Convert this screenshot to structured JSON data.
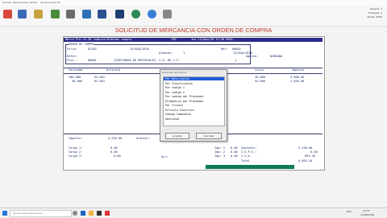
{
  "menu": [
    "Archivo",
    "Operaciones",
    "Ventas",
    "Ayuda Acerca de"
  ],
  "top_right": {
    "line1": "Usuario: 1",
    "line2": "Empresa: 1",
    "line3": "Fecha: 2020"
  },
  "app_title": "SOLICITUD DE MERCANCIA CON ORDEN DE COMPRA",
  "header": {
    "program": "Macro Pro v3.30 compras/Ordenes compra",
    "code": "750",
    "date_line": "Jue 13/Ago/20 13:36 0001.",
    "section": "ORDEN DE COMPRA",
    "folio_label": "Folio:",
    "folio_value": "OCO02",
    "date1": "13/AGO/2020",
    "ref_label": "Ref:",
    "ref_value": "00002",
    "date2": "13/AGO/2020",
    "almacen_label": "Almacen:",
    "almacen_value": "1",
    "refer_label": "Refer:",
    "agente_label": "Agente:",
    "agente_value": "NINGUNO",
    "prov_label": "Prov :",
    "prov_code": "00001",
    "prov_name": "[SURTIDORA DE MATERIALES, S.A. DE C.V.",
    "prov_end": "]"
  },
  "table": {
    "headers": [
      "Cantidad",
      "Articulo",
      "Costo",
      "Importe"
    ],
    "rows": [
      {
        "qty": "100.000",
        "art": "63-002",
        "cost": "36.000",
        "imp": "3,600.00"
      },
      {
        "qty": "50.000",
        "art": "63-001",
        "cost": "54.000",
        "imp": "1,620.00"
      }
    ]
  },
  "totals": {
    "importe_label": "Importe:",
    "importe_value": "5,220.00",
    "arancel_label": "Arancel:",
    "cargo1_label": "Cargo 1:",
    "cargo1_value": "0.00",
    "cargo2_label": "Cargo 2:",
    "cargo2_value": "0.00",
    "cargo3_label": "Cargo 3:",
    "cargo3_value": "0.00",
    "acr_label": "Acr:",
    "imp1_label": "Imp: 1",
    "imp1_value": "0.00",
    "imp2_label": "Imp: 2",
    "imp2_value": "0.00",
    "imp3_label": "Imp: 3",
    "imp3_value": "0.00",
    "subtotal_label": "Subtotal:",
    "subtotal_value": "5,220.00",
    "ieps_label": "I.E.P.S.:",
    "ieps_value": "0.00",
    "iva_label": "I.V.A.",
    "iva_value": "835.20",
    "total_label": "Total",
    "total_value": "6,055.20"
  },
  "dialog": {
    "title": "Busqueda del articulo",
    "items": [
      "Por Descripcion",
      "Por Clasificacion",
      "Por codigo 1",
      "Por codigo 2",
      "Por codigo del Proveedor",
      "Alfabetico por Proveedor",
      "Por Cliente",
      "Articulo Sustituto",
      "Codigo Compuesto",
      "Adicional"
    ],
    "selected_index": 0,
    "accept_label": "Aceptar",
    "cancel_label": "Cancelar"
  },
  "taskbar": {
    "search_placeholder": "Escribe aquí para buscar",
    "time": "13:37",
    "date": "13/08/2020",
    "lang": "ESP"
  },
  "colors": {
    "title": "#c0392b",
    "console_text": "#1a2b6b",
    "header_bar": "#2a2a8a",
    "selection": "#1e5bd8",
    "status_bar": "#0f7a5a"
  }
}
